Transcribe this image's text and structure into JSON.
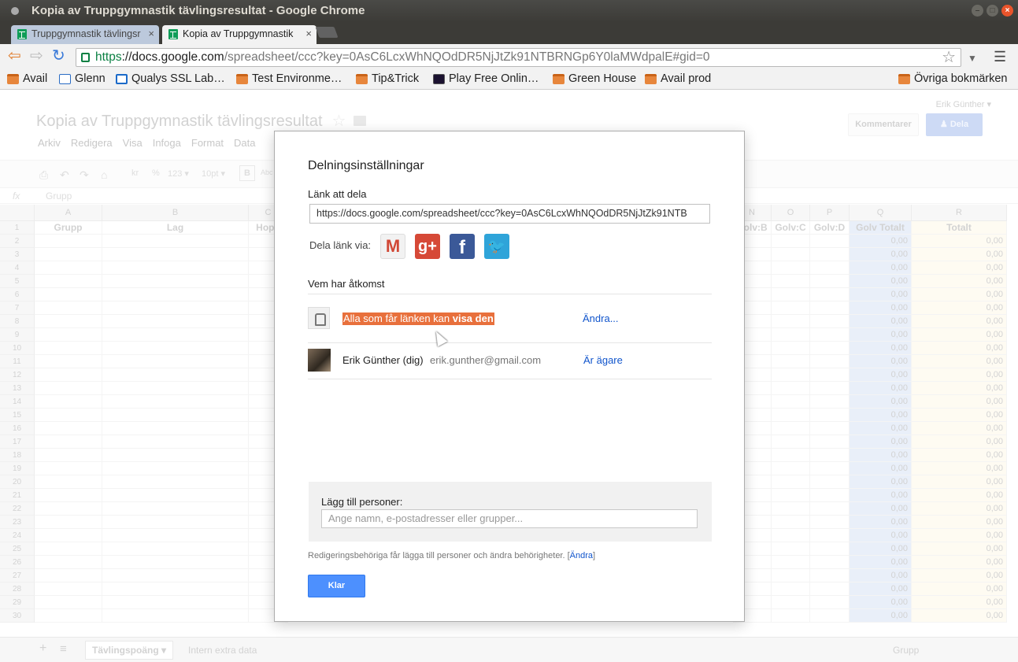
{
  "window": {
    "title": "Kopia av Truppgymnastik tävlingsresultat - Google Chrome"
  },
  "tabs": [
    {
      "label": "Truppgymnastik tävlingsr",
      "close": "×"
    },
    {
      "label": "Kopia av Truppgymnastik",
      "close": "×"
    }
  ],
  "toolbar": {
    "url_scheme": "https",
    "url_host": "://docs.google.com",
    "url_path": "/spreadsheet/ccc?key=0AsC6LcxWhNQOdDR5NjJtZk91NTBRNGp6Y0laMWdpalE#gid=0"
  },
  "bookmarks": [
    {
      "label": "Avail",
      "icon": "folder-icon"
    },
    {
      "label": "Glenn",
      "icon": "page-icon"
    },
    {
      "label": "Qualys SSL Lab…",
      "icon": "lock-icon"
    },
    {
      "label": "Test Environme…",
      "icon": "folder-icon"
    },
    {
      "label": "Tip&Trick",
      "icon": "folder-icon"
    },
    {
      "label": "Play Free Onlin…",
      "icon": "game-icon"
    },
    {
      "label": "Green House",
      "icon": "folder-icon"
    },
    {
      "label": "Avail prod",
      "icon": "folder-icon"
    },
    {
      "label": "Övriga bokmärken",
      "icon": "folder-icon"
    }
  ],
  "doc": {
    "title": "Kopia av Truppgymnastik tävlingsresultat",
    "menus": [
      "Arkiv",
      "Redigera",
      "Visa",
      "Infoga",
      "Format",
      "Data"
    ],
    "user": "Erik Günther ▾",
    "kommentarer": "Kommentarer",
    "dela": "Dela",
    "formula_cell": "Grupp",
    "formula_icon": "fx",
    "fmt": {
      "kr": "kr",
      "pct": "%",
      "num": "123 ▾",
      "size": "10pt ▾",
      "bold": "B",
      "abc": "Abc"
    }
  },
  "grid": {
    "columns": [
      "A",
      "B",
      "C",
      "N",
      "O",
      "P",
      "Q",
      "R"
    ],
    "header_row": {
      "A": "Grupp",
      "B": "Lag",
      "C": "Hopp",
      "N": "Golv:B",
      "O": "Golv:C",
      "P": "Golv:D",
      "Q": "Golv Totalt",
      "R": "Totalt"
    },
    "rows": [
      "1",
      "2",
      "3",
      "4",
      "5",
      "6",
      "7",
      "8",
      "9",
      "10",
      "11",
      "12",
      "13",
      "14",
      "15",
      "16",
      "17",
      "18",
      "19",
      "20",
      "21",
      "22",
      "23",
      "24",
      "25",
      "26",
      "27",
      "28",
      "29",
      "30"
    ],
    "zero": "0,00"
  },
  "sheet_tabs": {
    "add": "+",
    "list": "≡",
    "active": "Tävlingspoäng ▾",
    "other": "Intern extra data",
    "summary": "Grupp"
  },
  "dialog": {
    "title": "Delningsinställningar",
    "link_label": "Länk att dela",
    "link_value": "https://docs.google.com/spreadsheet/ccc?key=0AsC6LcxWhNQOdDR5NjJtZk91NTB",
    "share_via": "Dela länk via:",
    "who_access": "Vem har åtkomst",
    "access_prefix": "Alla som får länken kan ",
    "access_bold": "visa den",
    "change": "Ändra...",
    "owner_name": "Erik Günther (dig)",
    "owner_email": "erik.gunther@gmail.com",
    "owner_role": "Är ägare",
    "add_label": "Lägg till personer:",
    "add_placeholder": "Ange namn, e-postadresser eller grupper...",
    "note": "Redigeringsbehöriga får lägga till personer och ändra behörigheter.",
    "note_link": "Ändra",
    "done": "Klar"
  },
  "colors": {
    "accent": "#4d90fe",
    "highlight": "#e8703c",
    "link": "#1155cc"
  }
}
